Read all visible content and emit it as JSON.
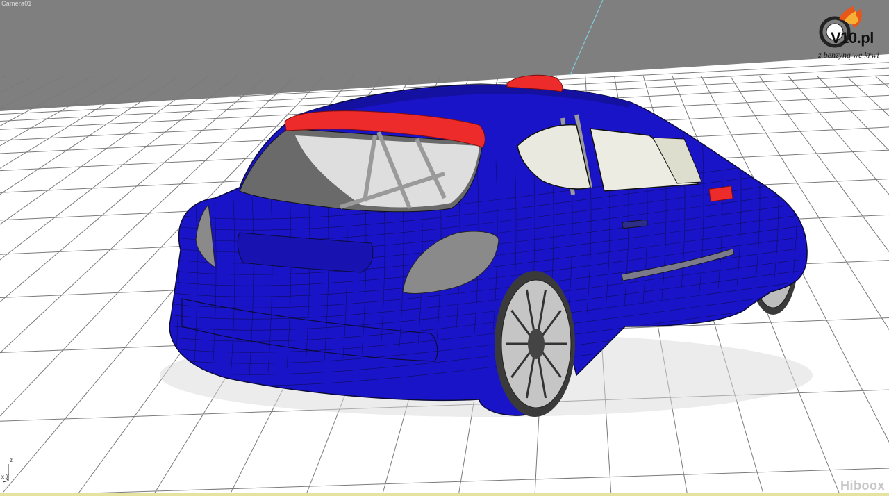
{
  "viewport": {
    "label": "Camera01",
    "background_top": "#7f7f7f",
    "floor_color": "#ffffff",
    "grid_color": "#555555"
  },
  "logo": {
    "text": "V10.pl",
    "tagline": "z benzyną we krwi",
    "flame_color": "#e8561a"
  },
  "watermark": {
    "text": "Hiboox"
  },
  "axis_gizmo": {
    "z_label": "z",
    "x_label": "x",
    "y_label": "y"
  },
  "model": {
    "body_color": "#1a14c8",
    "accent_color": "#ee2b2b",
    "wire_color": "#0b0b3a",
    "glass_color": "#5a5a5a",
    "wheel_color": "#8a8a8a"
  }
}
